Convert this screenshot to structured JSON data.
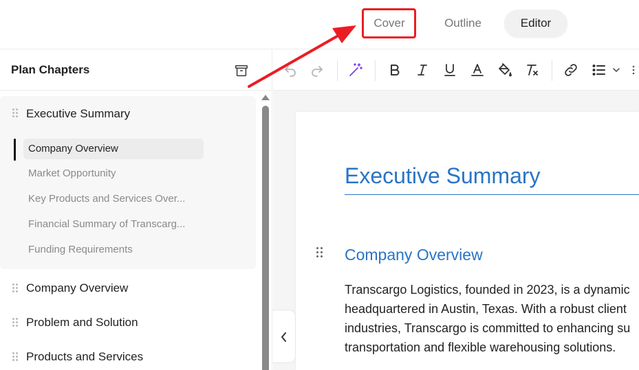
{
  "tabs": {
    "cover": "Cover",
    "outline": "Outline",
    "editor": "Editor"
  },
  "sidebar": {
    "title": "Plan Chapters",
    "chapters": [
      {
        "label": "Executive Summary",
        "subitems": [
          {
            "label": "Company Overview",
            "active": true
          },
          {
            "label": "Market Opportunity"
          },
          {
            "label": "Key Products and Services Over..."
          },
          {
            "label": "Financial Summary of Transcarg..."
          },
          {
            "label": "Funding Requirements"
          }
        ]
      },
      {
        "label": "Company Overview"
      },
      {
        "label": "Problem and Solution"
      },
      {
        "label": "Products and Services"
      }
    ]
  },
  "toolbar": {
    "icons": [
      "undo-icon",
      "redo-icon",
      "ai-magic-wand-icon",
      "bold-icon",
      "italic-icon",
      "underline-icon",
      "text-color-icon",
      "highlight-icon",
      "clear-format-icon",
      "link-icon",
      "list-icon",
      "chevron-down-icon",
      "more-icon"
    ]
  },
  "document": {
    "title": "Executive Summary",
    "heading": "Company Overview",
    "paragraph_lines": [
      "Transcargo Logistics, founded in 2023, is a dynamic",
      "headquartered in Austin, Texas. With a robust client",
      "industries, Transcargo is committed to enhancing su",
      "transportation and flexible warehousing solutions."
    ]
  },
  "colors": {
    "accent_blue": "#2a74c6",
    "annotation_red": "#ec1c24",
    "magic_purple": "#7b3fe4"
  }
}
